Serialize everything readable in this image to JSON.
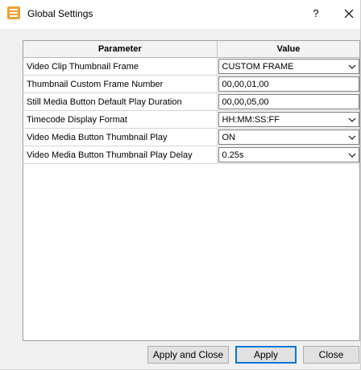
{
  "window": {
    "title": "Global Settings",
    "help_label": "?"
  },
  "table": {
    "headers": [
      "Parameter",
      "Value"
    ],
    "rows": [
      {
        "parameter": "Video Clip Thumbnail Frame",
        "value": "CUSTOM FRAME",
        "control": "dropdown"
      },
      {
        "parameter": "Thumbnail Custom Frame Number",
        "value": "00,00,01,00",
        "control": "text"
      },
      {
        "parameter": "Still Media Button Default Play Duration",
        "value": "00,00,05,00",
        "control": "text"
      },
      {
        "parameter": "Timecode Display Format",
        "value": "HH:MM:SS:FF",
        "control": "dropdown"
      },
      {
        "parameter": "Video Media Button Thumbnail Play",
        "value": "ON",
        "control": "dropdown"
      },
      {
        "parameter": "Video Media Button Thumbnail Play Delay",
        "value": "0.25s",
        "control": "dropdown"
      }
    ]
  },
  "buttons": {
    "apply_and_close": "Apply and Close",
    "apply": "Apply",
    "close": "Close"
  },
  "colors": {
    "accent": "#0078d7",
    "icon": "#f0a030"
  },
  "icons": {
    "app": "settings-list-icon",
    "close": "close-icon",
    "dropdown": "chevron-down-icon"
  }
}
